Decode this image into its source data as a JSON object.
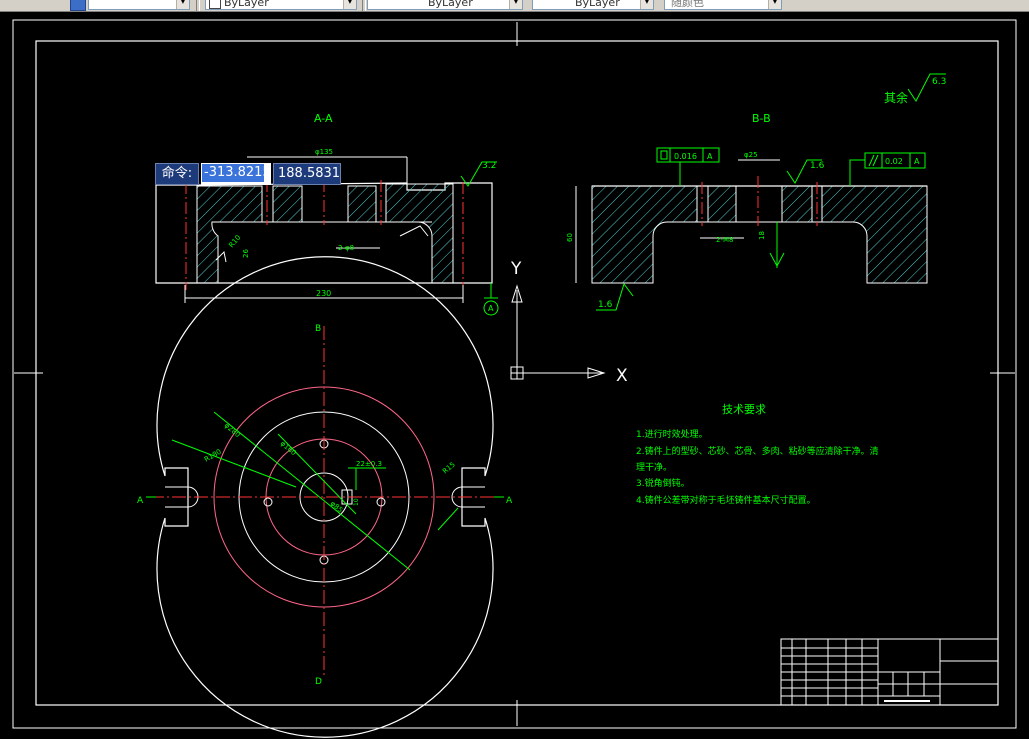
{
  "toolbar": {
    "layer_value": "",
    "color_value": "ByLayer",
    "linetype_value": "ByLayer",
    "lineweight_value": "ByLayer",
    "plotstyle_value": "随颜色"
  },
  "command_input": {
    "label": "命令:",
    "x_value": "-313.8215",
    "y_value": "188.5831"
  },
  "drawing": {
    "section_aa_label": "A-A",
    "section_bb_label": "B-B",
    "remaining_roughness": "其余",
    "remaining_roughness_value": "6.3",
    "roughness_aa_top": "3.2",
    "roughness_bb_top": "1.6",
    "roughness_bb_bottom": "1.6",
    "dim_aa_width": "230",
    "dim_aa_phi135": "φ135",
    "dim_aa_holes": "2-φ8",
    "dim_aa_r10": "R10",
    "dim_aa_depth": "26",
    "dim_bb_phi": "φ25",
    "dim_bb_height": "60",
    "dim_bb_holes": "2-M8",
    "dim_bb_depth": "18",
    "flatness": "0.016",
    "flatness_datum": "A",
    "parallelism": "0.02",
    "parallelism_datum": "A",
    "datum_a": "A",
    "plan_label_b": "B",
    "plan_label_d": "D",
    "plan_label_a_left": "A",
    "plan_label_a_right": "A",
    "plan_r180": "R180",
    "plan_phi280": "φ280",
    "plan_phi160": "φ160",
    "plan_phi85": "φ85",
    "plan_r15": "R15",
    "plan_keyway": "22±0.3",
    "plan_keyway_depth": "10",
    "ucs_x": "X",
    "ucs_y": "Y"
  },
  "tech_requirements": {
    "title": "技术要求",
    "item1": "1.进行时效处理。",
    "item2a": "2.铸件上的型砂、芯砂、芯骨、多肉、粘砂等应清除干净。清",
    "item2b": "理干净。",
    "item3": "3.锐角倒钝。",
    "item4": "4.铸件公差带对称于毛坯铸件基本尺寸配置。"
  }
}
